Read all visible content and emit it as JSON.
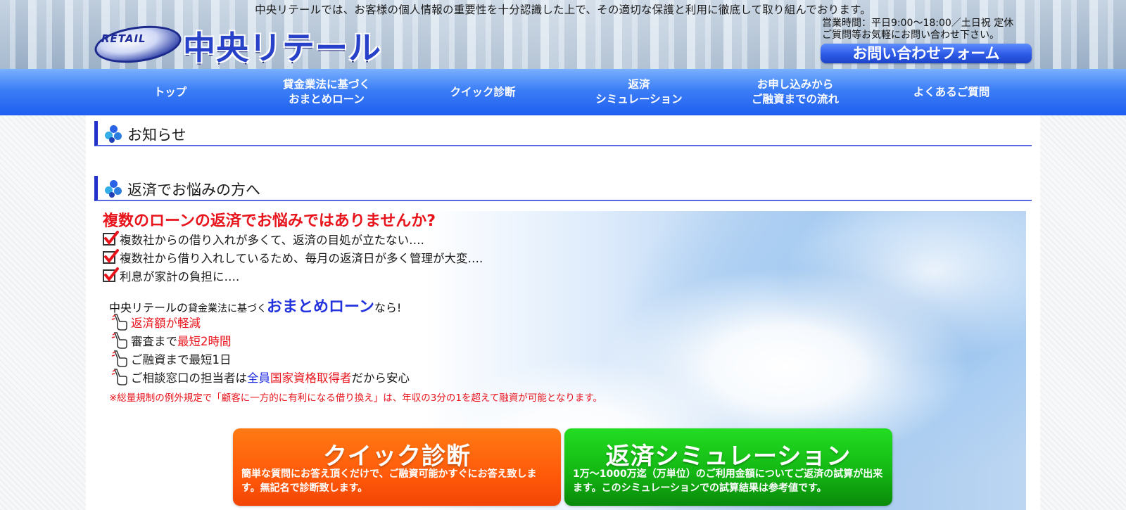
{
  "header": {
    "tagline": "中央リテールでは、お客様の個人情報の重要性を十分認識した上で、その適切な保護と利用に徹底して取り組んでおります。",
    "logo_badge": "RETAIL",
    "logo_name": "中央リテール",
    "hours_line1": "営業時間：平日9:00〜18:00／土日祝 定休",
    "hours_line2": "ご質問等お気軽にお問い合わせ下さい。",
    "contact_button": "お問い合わせフォーム"
  },
  "nav": {
    "items": [
      {
        "label": "トップ"
      },
      {
        "label": "貸金業法に基づく\nおまとめローン"
      },
      {
        "label": "クイック診断"
      },
      {
        "label": "返済\nシミュレーション"
      },
      {
        "label": "お申し込みから\nご融資までの流れ"
      },
      {
        "label": "よくあるご質問"
      }
    ]
  },
  "sections": {
    "news_title": "お知らせ",
    "worry_title": "返済でお悩みの方へ"
  },
  "hero": {
    "question": "複数のローンの返済でお悩みではありませんか?",
    "checks": [
      "複数社からの借り入れが多くて、返済の目処が立たない….",
      "複数社から借り入れしているため、毎月の返済日が多く管理が大変….",
      "利息が家計の負担に…."
    ],
    "intro_part1": "中央リテールの",
    "intro_part2": "貸金業法に基づく",
    "intro_part3": "おまとめローン",
    "intro_part4": "なら!",
    "point1": "返済額が軽減",
    "point2_prefix": "審査まで",
    "point2_highlight": "最短2時間",
    "point3": "ご融資まで最短1日",
    "point4_prefix": "ご相談窓口の担当者は",
    "point4_blue": "全員",
    "point4_red": "国家資格取得者",
    "point4_suffix": "だから安心",
    "note": "※総量規制の例外規定で「顧客に一方的に有利になる借り換え」は、年収の3分の1を超えて融資が可能となります。"
  },
  "cta": {
    "quick_title": "クイック診断",
    "quick_desc": "簡単な質問にお答え頂くだけで、ご融資可能かすぐにお答え致します。無記名で診断致します。",
    "sim_title": "返済シミュレーション",
    "sim_desc": "1万〜1000万迄（万単位）のご利用金額についてご返済の試算が出来ます。このシミュレーションでの試算結果は参考値です。"
  },
  "colors": {
    "nav_blue": "#3c7ef6",
    "accent_red": "#e8141c",
    "accent_blue": "#1f2fe0",
    "cta_orange": "#ff5a0a",
    "cta_green": "#14b814"
  }
}
